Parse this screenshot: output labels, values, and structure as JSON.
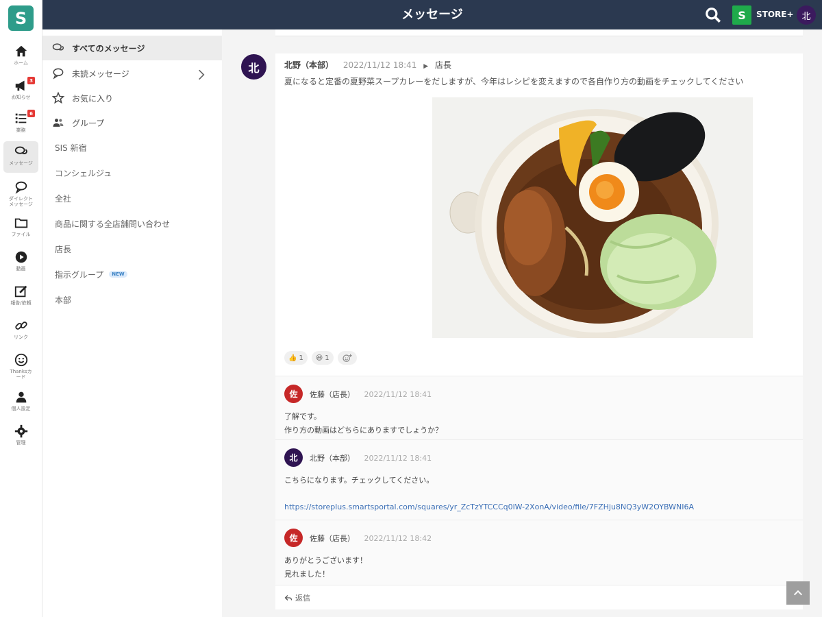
{
  "header": {
    "title": "メッセージ",
    "store_letter": "S",
    "store_name": "STORE+",
    "user_initial": "北"
  },
  "rail": {
    "logo": "S",
    "items": [
      {
        "label": "ホーム",
        "icon": "home-icon"
      },
      {
        "label": "お知らせ",
        "icon": "megaphone-icon",
        "badge": "3"
      },
      {
        "label": "業務",
        "icon": "task-list-icon",
        "badge": "6"
      },
      {
        "label": "メッセージ",
        "icon": "chat-bubbles-icon"
      },
      {
        "label": "ダイレクト\nメッセージ",
        "icon": "direct-message-icon"
      },
      {
        "label": "ファイル",
        "icon": "folder-icon"
      },
      {
        "label": "動画",
        "icon": "play-icon"
      },
      {
        "label": "報告/依頼",
        "icon": "edit-icon"
      },
      {
        "label": "リンク",
        "icon": "link-icon"
      },
      {
        "label": "Thanksカ\nード",
        "icon": "smile-icon"
      },
      {
        "label": "個人設定",
        "icon": "user-icon"
      },
      {
        "label": "管理",
        "icon": "gear-icon"
      }
    ]
  },
  "side": {
    "items": [
      {
        "label": "すべてのメッセージ"
      },
      {
        "label": "未読メッセージ"
      },
      {
        "label": "お気に入り"
      },
      {
        "label": "グループ"
      },
      {
        "label": "SIS 新宿"
      },
      {
        "label": "コンシェルジュ"
      },
      {
        "label": "全社"
      },
      {
        "label": "商品に関する全店舗問い合わせ"
      },
      {
        "label": "店長"
      },
      {
        "label": "指示グループ",
        "badge": "NEW"
      },
      {
        "label": "本部"
      }
    ]
  },
  "post": {
    "avatar": "北",
    "author": "北野（本部）",
    "time": "2022/11/12 18:41",
    "channel": "店長",
    "text": "夏になると定番の夏野菜スープカレーをだしますが、今年はレシピを変えますので各自作り方の動画をチェックしてください",
    "reactions": [
      {
        "emoji": "👍",
        "count": "1"
      },
      {
        "emoji": "😆",
        "count": "1"
      }
    ]
  },
  "replies": [
    {
      "avatar": "佐",
      "color": "#c62828",
      "author": "佐藤（店長）",
      "time": "2022/11/12 18:41",
      "line1": "了解です。",
      "line2": "作り方の動画はどちらにありますでしょうか？"
    },
    {
      "avatar": "北",
      "color": "#2f1452",
      "author": "北野（本部）",
      "time": "2022/11/12 18:41",
      "line1": "こちらになります。チェックしてください。",
      "link": "https://storeplus.smartsportal.com/squares/yr_ZcTzYTCCCq0lW-2XonA/video/file/7FZHju8NQ3yW2OYBWNI6A"
    },
    {
      "avatar": "佐",
      "color": "#c62828",
      "author": "佐藤（店長）",
      "time": "2022/11/12 18:42",
      "line1": "ありがとうございます！",
      "line2": "見れました！"
    }
  ],
  "reply_bar": {
    "label": "返信"
  }
}
